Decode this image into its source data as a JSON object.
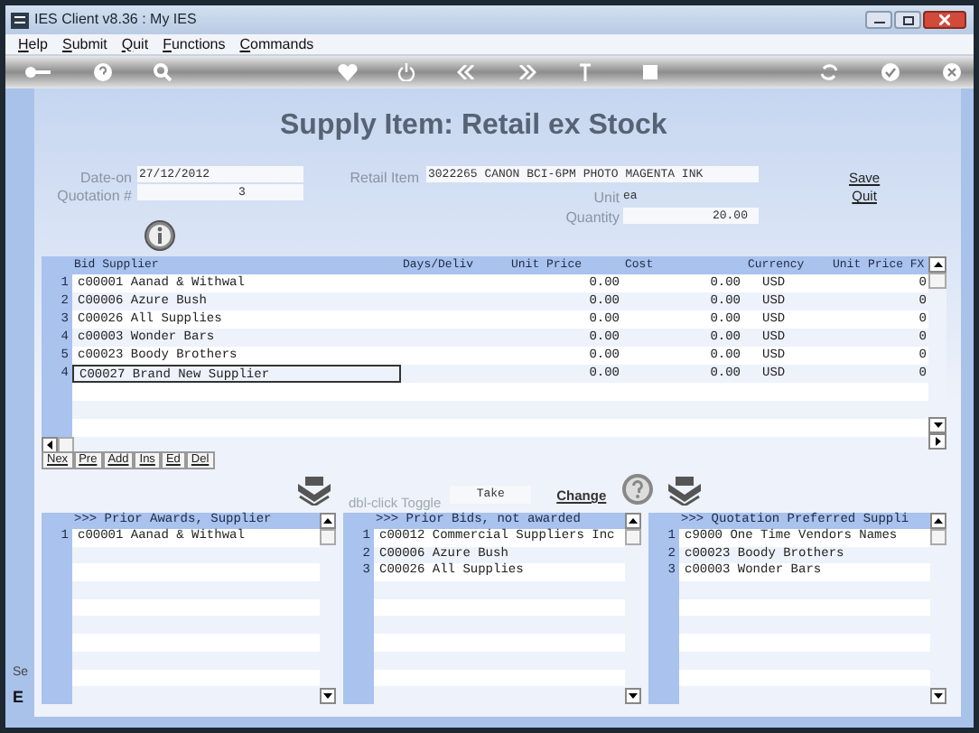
{
  "window": {
    "title": "IES Client v8.36 : My IES"
  },
  "menu": [
    "Help",
    "Submit",
    "Quit",
    "Functions",
    "Commands"
  ],
  "heading": "Supply Item: Retail ex Stock",
  "form": {
    "date_on": {
      "label": "Date-on",
      "value": "27/12/2012"
    },
    "quotation": {
      "label": "Quotation #",
      "value": "3"
    },
    "retail_item": {
      "label": "Retail Item",
      "value": "3022265 CANON BCI-6PM PHOTO MAGENTA INK"
    },
    "unit": {
      "label": "Unit",
      "value": "ea"
    },
    "quantity": {
      "label": "Quantity",
      "value": "20.00"
    }
  },
  "links": [
    "Save",
    "Quit"
  ],
  "bids": {
    "columns": [
      "Bid Supplier",
      "Days/Deliv",
      "Unit Price",
      "Cost",
      "Currency",
      "Unit Price FX"
    ],
    "rows": [
      {
        "num": "1",
        "supplier": "c00001 Aanad & Withwal",
        "unit_price": "0.00",
        "cost": "0.00",
        "currency": "USD",
        "unit_price_fx": "0",
        "focused": false
      },
      {
        "num": "2",
        "supplier": "C00006 Azure Bush",
        "unit_price": "0.00",
        "cost": "0.00",
        "currency": "USD",
        "unit_price_fx": "0",
        "focused": false
      },
      {
        "num": "3",
        "supplier": "C00026 All Supplies",
        "unit_price": "0.00",
        "cost": "0.00",
        "currency": "USD",
        "unit_price_fx": "0",
        "focused": false
      },
      {
        "num": "4",
        "supplier": "c00003 Wonder Bars",
        "unit_price": "0.00",
        "cost": "0.00",
        "currency": "USD",
        "unit_price_fx": "0",
        "focused": false
      },
      {
        "num": "5",
        "supplier": "c00023 Boody Brothers",
        "unit_price": "0.00",
        "cost": "0.00",
        "currency": "USD",
        "unit_price_fx": "0",
        "focused": false
      },
      {
        "num": "4",
        "supplier": "C00027 Brand New Supplier",
        "unit_price": "0.00",
        "cost": "0.00",
        "currency": "USD",
        "unit_price_fx": "0",
        "focused": true
      }
    ]
  },
  "grid_buttons": [
    "Nex",
    "Pre",
    "Add",
    "Ins",
    "Ed",
    "Del"
  ],
  "toggle": {
    "label": "dbl-click Toggle",
    "value": "Take"
  },
  "change_link": "Change",
  "panels": [
    {
      "title": ">>> Prior Awards, Supplier",
      "rows": [
        {
          "num": "1",
          "text": "c00001 Aanad & Withwal"
        }
      ]
    },
    {
      "title": ">>> Prior Bids, not awarded",
      "rows": [
        {
          "num": "1",
          "text": "c00012 Commercial Suppliers Inc"
        },
        {
          "num": "2",
          "text": "C00006 Azure Bush"
        },
        {
          "num": "3",
          "text": "C00026 All Supplies"
        }
      ]
    },
    {
      "title": ">>> Quotation Preferred Suppli",
      "rows": [
        {
          "num": "1",
          "text": "c9000 One Time Vendors Names"
        },
        {
          "num": "2",
          "text": "c00023 Boody Brothers"
        },
        {
          "num": "3",
          "text": "c00003 Wonder Bars"
        }
      ]
    }
  ],
  "side_text": [
    "Se",
    "E"
  ]
}
